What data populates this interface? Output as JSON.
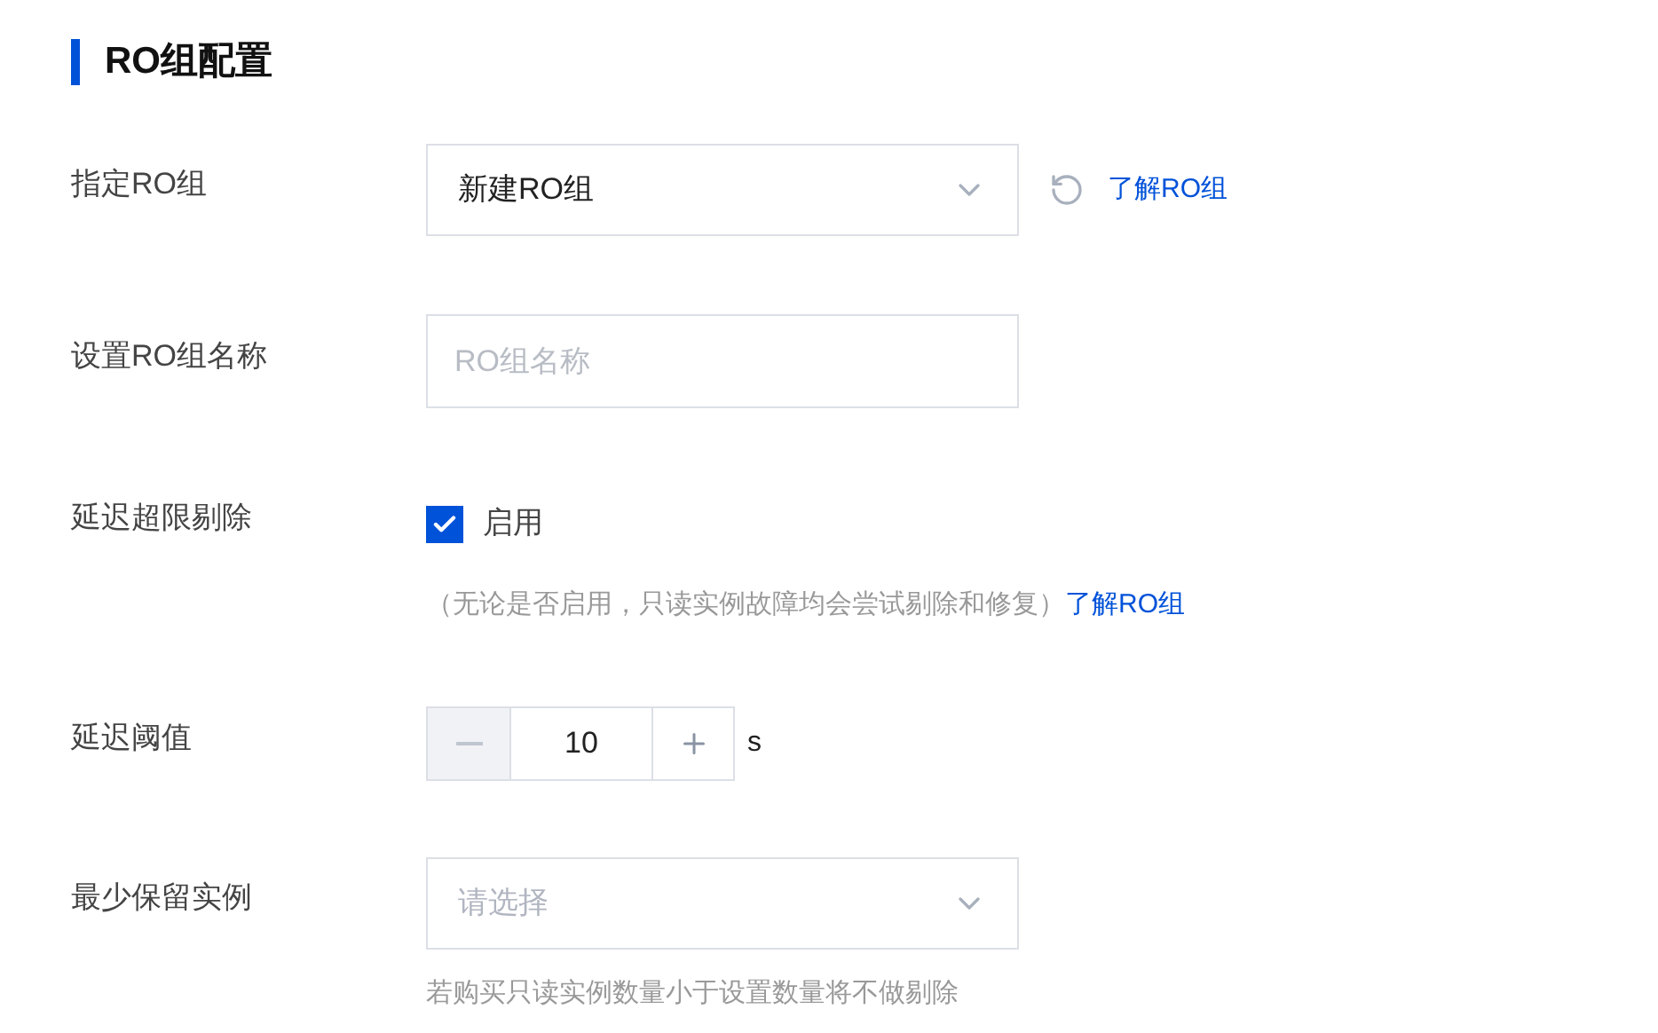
{
  "section": {
    "title": "RO组配置"
  },
  "fields": [
    {
      "kind": "select",
      "label": "指定RO组",
      "value": "新建RO组",
      "link": "了解RO组"
    },
    {
      "kind": "input",
      "label": "设置RO组名称",
      "placeholder": "RO组名称"
    },
    {
      "kind": "checkbox",
      "label": "延迟超限剔除",
      "option": "启用",
      "checked": true,
      "note": "（无论是否启用，只读实例故障均会尝试剔除和修复）",
      "link": "了解RO组"
    },
    {
      "kind": "stepper",
      "label": "延迟阈值",
      "value": "10",
      "decrement_disabled": true,
      "increment_disabled": false,
      "unit": "s"
    },
    {
      "kind": "select",
      "label": "最少保留实例",
      "placeholder": "请选择",
      "hint": "若购买只读实例数量小于设置数量将不做剔除"
    }
  ]
}
